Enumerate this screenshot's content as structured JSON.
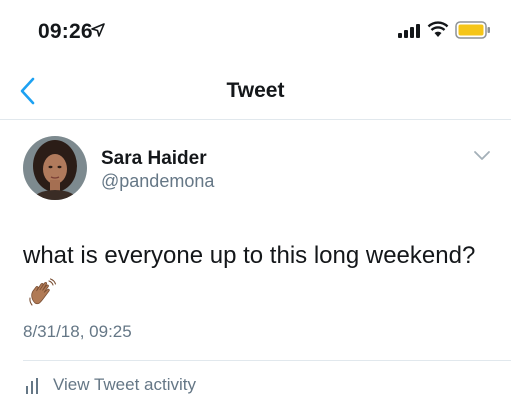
{
  "status_bar": {
    "time": "09:26",
    "icons": [
      "location-arrow-icon",
      "cellular-signal-icon",
      "wifi-icon",
      "battery-icon"
    ],
    "battery_color": "#f5c518"
  },
  "nav": {
    "title": "Tweet",
    "back_icon": "chevron-left-icon",
    "accent_color": "#1da1f2"
  },
  "tweet": {
    "author_name": "Sara Haider",
    "author_handle": "@pandemona",
    "text": "what is everyone up to this long weekend?",
    "emoji": "waving-hand-icon",
    "timestamp": "8/31/18, 09:25",
    "menu_icon": "chevron-down-icon"
  },
  "activity": {
    "label": "View Tweet activity",
    "icon": "bar-chart-icon"
  },
  "colors": {
    "text_primary": "#14171a",
    "text_secondary": "#657786",
    "divider": "#e1e8ed"
  }
}
